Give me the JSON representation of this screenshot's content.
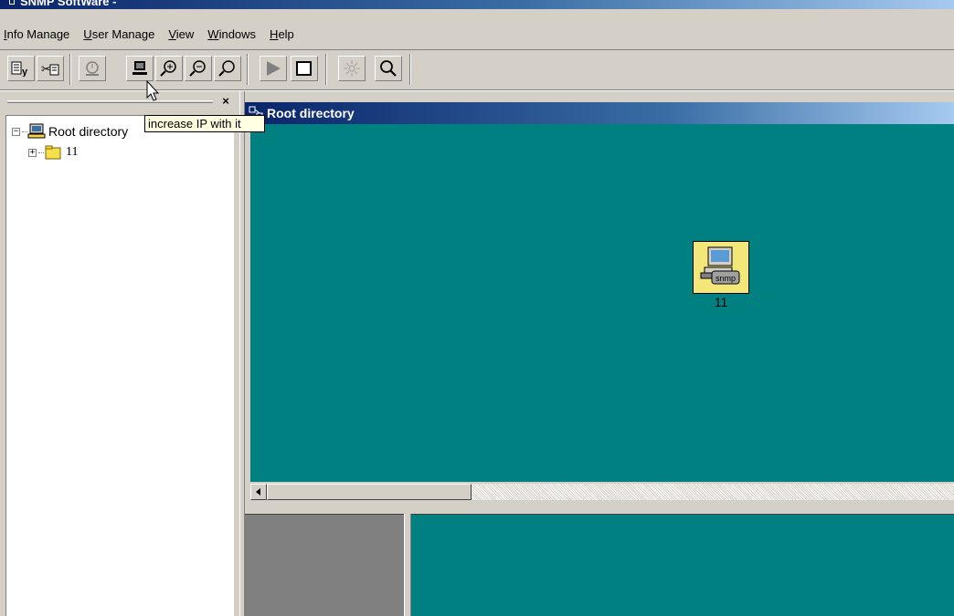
{
  "window": {
    "title": "SNMP SoftWare -",
    "icon": "network-icon"
  },
  "menubar": {
    "items": [
      {
        "label": "Info Manage",
        "accel": "I"
      },
      {
        "label": "User Manage",
        "accel": "U"
      },
      {
        "label": "View",
        "accel": "V"
      },
      {
        "label": "Windows",
        "accel": "W"
      },
      {
        "label": "Help",
        "accel": "H"
      }
    ]
  },
  "toolbar": {
    "buttons": [
      {
        "icon": "properties-icon"
      },
      {
        "icon": "cut-icon"
      },
      {
        "icon": "alarm-icon"
      },
      {
        "icon": "computer-icon"
      },
      {
        "icon": "zoom-in-icon"
      },
      {
        "icon": "zoom-out-icon"
      },
      {
        "icon": "zoom-icon"
      },
      {
        "icon": "play-icon"
      },
      {
        "icon": "stop-icon"
      },
      {
        "icon": "light-icon"
      },
      {
        "icon": "search-icon"
      }
    ]
  },
  "tooltip": {
    "text": "increase IP with it"
  },
  "tree": {
    "close_label": "×",
    "root": {
      "label": "Root directory",
      "expander": "−"
    },
    "children": [
      {
        "label": "11",
        "expander": "+"
      }
    ]
  },
  "child_window": {
    "title": "Root directory",
    "nodes": [
      {
        "label": "11",
        "badge": "snmp"
      }
    ]
  },
  "colors": {
    "desktop_teal": "#008080",
    "titlebar_start": "#0a246a",
    "titlebar_end": "#a6caf0",
    "face": "#d4d0c8",
    "node_bg": "#f3e77a"
  }
}
